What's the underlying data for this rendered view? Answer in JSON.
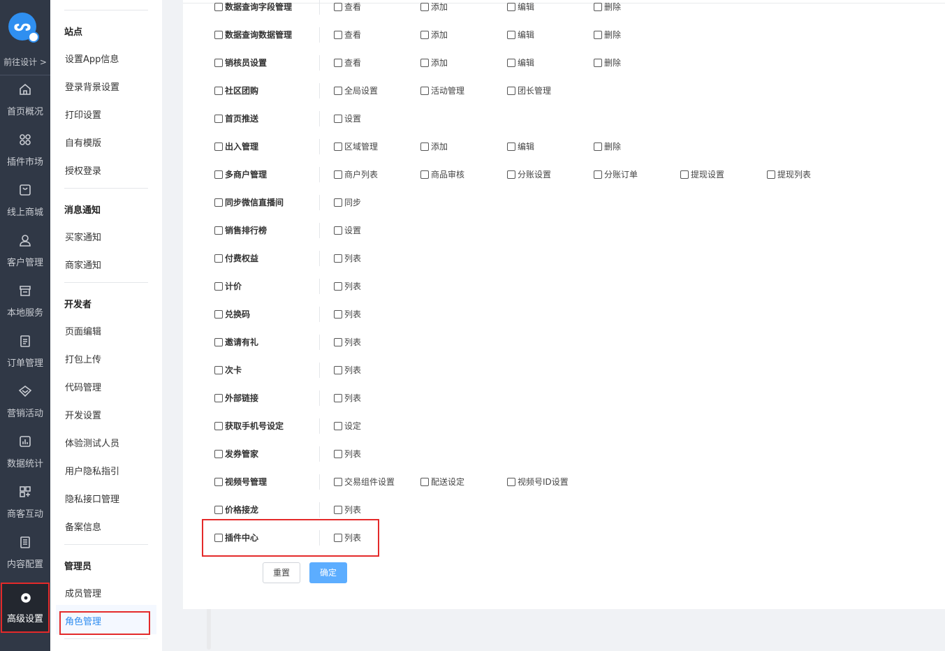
{
  "rail": {
    "goto": "前往设计 >",
    "items": [
      {
        "label": "首页概况",
        "icon": "home-icon"
      },
      {
        "label": "插件市场",
        "icon": "grid-icon"
      },
      {
        "label": "线上商城",
        "icon": "shop-bag-icon"
      },
      {
        "label": "客户管理",
        "icon": "user-icon"
      },
      {
        "label": "本地服务",
        "icon": "store-icon"
      },
      {
        "label": "订单管理",
        "icon": "order-icon"
      },
      {
        "label": "营销活动",
        "icon": "diamond-icon"
      },
      {
        "label": "数据统计",
        "icon": "chart-icon"
      },
      {
        "label": "商客互动",
        "icon": "interaction-icon"
      },
      {
        "label": "内容配置",
        "icon": "document-icon"
      },
      {
        "label": "高级设置",
        "icon": "gear-icon"
      }
    ]
  },
  "submenu": {
    "sections": [
      {
        "title": "站点",
        "items": [
          "设置App信息",
          "登录背景设置",
          "打印设置",
          "自有模版",
          "授权登录"
        ]
      },
      {
        "title": "消息通知",
        "items": [
          "买家通知",
          "商家通知"
        ]
      },
      {
        "title": "开发者",
        "items": [
          "页面编辑",
          "打包上传",
          "代码管理",
          "开发设置",
          "体验测试人员",
          "用户隐私指引",
          "隐私接口管理",
          "备案信息"
        ]
      },
      {
        "title": "管理员",
        "items": [
          "成员管理",
          "角色管理"
        ]
      }
    ]
  },
  "permissions": [
    {
      "name": "数据查询字段管理",
      "options": [
        "查看",
        "添加",
        "编辑",
        "删除"
      ]
    },
    {
      "name": "数据查询数据管理",
      "options": [
        "查看",
        "添加",
        "编辑",
        "删除"
      ]
    },
    {
      "name": "销核员设置",
      "options": [
        "查看",
        "添加",
        "编辑",
        "删除"
      ]
    },
    {
      "name": "社区团购",
      "options": [
        "全局设置",
        "活动管理",
        "团长管理"
      ]
    },
    {
      "name": "首页推送",
      "options": [
        "设置"
      ]
    },
    {
      "name": "出入管理",
      "options": [
        "区域管理",
        "添加",
        "编辑",
        "删除"
      ]
    },
    {
      "name": "多商户管理",
      "options": [
        "商户列表",
        "商品审核",
        "分账设置",
        "分账订单",
        "提现设置",
        "提现列表"
      ]
    },
    {
      "name": "同步微信直播间",
      "options": [
        "同步"
      ]
    },
    {
      "name": "销售排行榜",
      "options": [
        "设置"
      ]
    },
    {
      "name": "付费权益",
      "options": [
        "列表"
      ]
    },
    {
      "name": "计价",
      "options": [
        "列表"
      ]
    },
    {
      "name": "兑换码",
      "options": [
        "列表"
      ]
    },
    {
      "name": "邀请有礼",
      "options": [
        "列表"
      ]
    },
    {
      "name": "次卡",
      "options": [
        "列表"
      ]
    },
    {
      "name": "外部链接",
      "options": [
        "列表"
      ]
    },
    {
      "name": "获取手机号设定",
      "options": [
        "设定"
      ]
    },
    {
      "name": "发券管家",
      "options": [
        "列表"
      ]
    },
    {
      "name": "视频号管理",
      "options": [
        "交易组件设置",
        "配送设定",
        "视频号ID设置"
      ]
    },
    {
      "name": "价格接龙",
      "options": [
        "列表"
      ]
    },
    {
      "name": "插件中心",
      "options": [
        "列表"
      ]
    }
  ],
  "buttons": {
    "reset": "重置",
    "confirm": "确定"
  }
}
